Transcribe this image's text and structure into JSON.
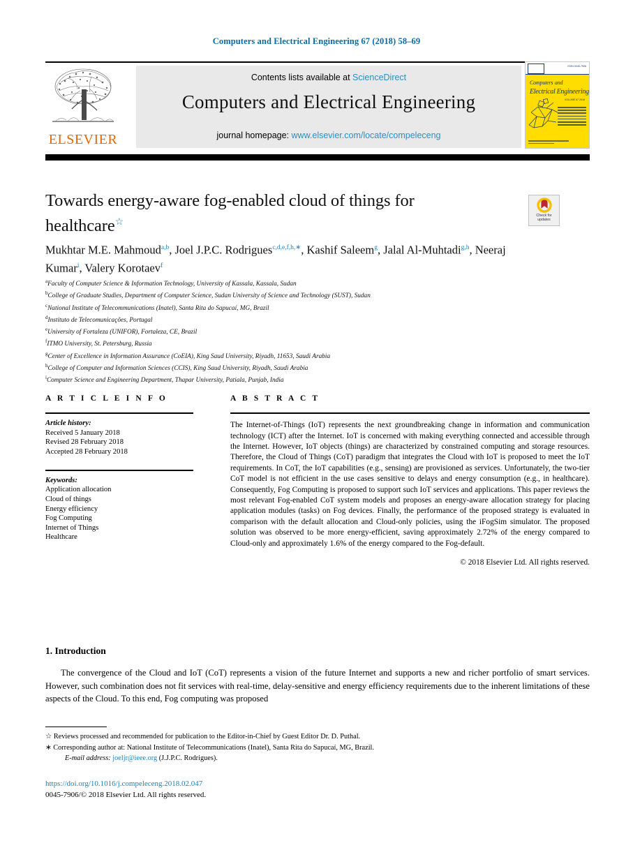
{
  "running_head": "Computers and Electrical Engineering 67 (2018) 58–69",
  "masthead": {
    "publisher_logo_text": "ELSEVIER",
    "contents_prefix": "Contents lists available at ",
    "contents_link": "ScienceDirect",
    "journal_title": "Computers and Electrical Engineering",
    "homepage_prefix": "journal homepage: ",
    "homepage_link": "www.elsevier.com/locate/compeleceng",
    "cover": {
      "title_line1": "Computers",
      "title_line1_small": "and",
      "title_line2": "Electrical Engineering",
      "issn_text": "ISSN 0045-7906",
      "sub_text": "VOLUME 67  2018"
    }
  },
  "article": {
    "title": "Towards energy-aware fog-enabled cloud of things for healthcare",
    "title_footnote_marker": "☆",
    "crossmark": {
      "line1": "Check for",
      "line2": "updates"
    },
    "authors_html": "Mukhtar M.E. Mahmoud<sup>a,b</sup>, Joel J.P.C. Rodrigues<sup>c,d,e,f,h,<span class=\"ast\">∗</span></sup>, Kashif Saleem<sup>g</sup>, Jalal Al-Muhtadi<sup>g,h</sup>, Neeraj Kumar<sup>i</sup>, Valery Korotaev<sup>f</sup>",
    "affiliations": [
      {
        "marker": "a",
        "text": "Faculty of Computer Science & Information Technology, University of Kassala, Kassala, Sudan"
      },
      {
        "marker": "b",
        "text": "College of Graduate Studies, Department of Computer Science, Sudan University of Science and Technology (SUST), Sudan"
      },
      {
        "marker": "c",
        "text": "National Institute of Telecommunications (Inatel), Santa Rita do Sapucaí, MG, Brazil"
      },
      {
        "marker": "d",
        "text": "Instituto de Telecomunicações, Portugal"
      },
      {
        "marker": "e",
        "text": "University of Fortaleza (UNIFOR), Fortaleza, CE, Brazil"
      },
      {
        "marker": "f",
        "text": "ITMO University, St. Petersburg, Russia"
      },
      {
        "marker": "g",
        "text": "Center of Excellence in Information Assurance (CoEIA), King Saud University, Riyadh, 11653, Saudi Arabia"
      },
      {
        "marker": "h",
        "text": "College of Computer and Information Sciences (CCIS), King Saud University, Riyadh, Saudi Arabia"
      },
      {
        "marker": "i",
        "text": "Computer Science and Engineering Department, Thapar University, Patiala, Punjab, India"
      }
    ]
  },
  "info": {
    "heading": "A R T I C L E   I N F O",
    "history_label": "Article history:",
    "history": [
      "Received 5 January 2018",
      "Revised 28 February 2018",
      "Accepted 28 February 2018"
    ],
    "keywords_label": "Keywords:",
    "keywords": [
      "Application allocation",
      "Cloud of things",
      "Energy efficiency",
      "Fog Computing",
      "Internet of Things",
      "Healthcare"
    ]
  },
  "abstract": {
    "heading": "A B S T R A C T",
    "text": "The Internet-of-Things (IoT) represents the next groundbreaking change in information and communication technology (ICT) after the Internet. IoT is concerned with making everything connected and accessible through the Internet. However, IoT objects (things) are characterized by constrained computing and storage resources. Therefore, the Cloud of Things (CoT) paradigm that integrates the Cloud with IoT is proposed to meet the IoT requirements. In CoT, the IoT capabilities (e.g., sensing) are provisioned as services. Unfortunately, the two-tier CoT model is not efficient in the use cases sensitive to delays and energy consumption (e.g., in healthcare). Consequently, Fog Computing is proposed to support such IoT services and applications. This paper reviews the most relevant Fog-enabled CoT system models and proposes an energy-aware allocation strategy for placing application modules (tasks) on Fog devices. Finally, the performance of the proposed strategy is evaluated in comparison with the default allocation and Cloud-only policies, using the iFogSim simulator. The proposed solution was observed to be more energy-efficient, saving approximately 2.72% of the energy compared to Cloud-only and approximately 1.6% of the energy compared to the Fog-default.",
    "copyright": "© 2018 Elsevier Ltd. All rights reserved."
  },
  "introduction": {
    "heading": "1. Introduction",
    "paragraph": "The convergence of the Cloud and IoT (CoT) represents a vision of the future Internet and supports a new and richer portfolio of smart services. However, such combination does not fit services with real-time, delay-sensitive and energy efficiency requirements due to the inherent limitations of these aspects of the Cloud. To this end, Fog computing was proposed"
  },
  "footnotes": {
    "star_marker": "☆",
    "star_text": "Reviews processed and recommended for publication to the Editor-in-Chief by Guest Editor Dr. D. Puthal.",
    "corr_marker": "∗",
    "corr_text": "Corresponding author at: National Institute of Telecommunications (Inatel), Santa Rita do Sapucaí, MG, Brazil.",
    "email_label": "E-mail address:",
    "email": "joeljr@ieee.org",
    "email_suffix": "(J.J.P.C. Rodrigues).",
    "doi": "https://doi.org/10.1016/j.compeleceng.2018.02.047",
    "issn_copyright": "0045-7906/© 2018 Elsevier Ltd. All rights reserved."
  },
  "colors": {
    "link_blue": "#1f7fb5",
    "masthead_link": "#2a8fc4",
    "elsevier_orange": "#eb6500",
    "cover_yellow": "#ffdd00",
    "cover_navy": "#15335f",
    "crossmark_gold": "#f2c200",
    "crossmark_red": "#c0272d"
  }
}
